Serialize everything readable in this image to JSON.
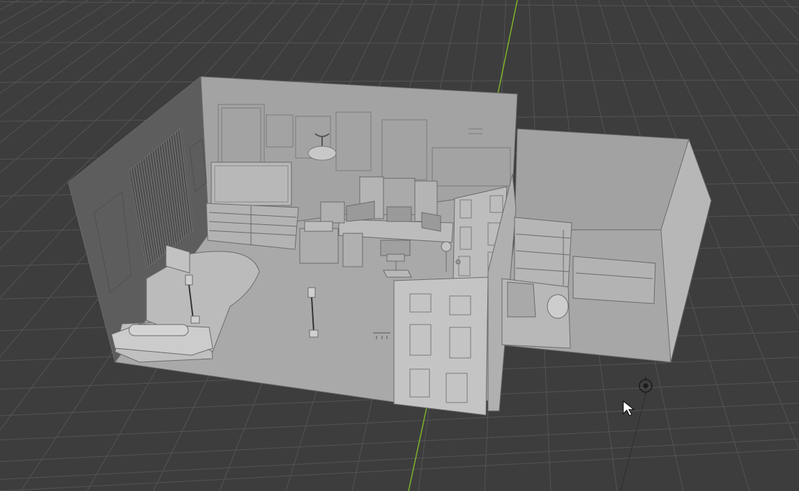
{
  "viewport": {
    "mode": "3d-viewport-solid-shading",
    "colors": {
      "background": "#3d3d3d",
      "grid": "#545454",
      "axis_y": "#7fb52a",
      "floor": "#a9a9a9",
      "wall_back": "#9f9f9f",
      "wall_left": "#5e5e5e",
      "wall_right": "#a5a5a5",
      "furniture": "#b4b4b4",
      "edge": "#6a6a6a"
    }
  },
  "scene": {
    "objects": [
      {
        "name": "bed"
      },
      {
        "name": "window-blinds"
      },
      {
        "name": "dresser"
      },
      {
        "name": "tv-screen"
      },
      {
        "name": "desk"
      },
      {
        "name": "monitors"
      },
      {
        "name": "office-chair"
      },
      {
        "name": "ceiling-lamp"
      },
      {
        "name": "floor-lamp"
      },
      {
        "name": "paneled-door-open"
      },
      {
        "name": "paneled-door-front"
      },
      {
        "name": "shelf-unit"
      },
      {
        "name": "cabinet"
      },
      {
        "name": "trash-bin"
      }
    ]
  },
  "gizmo": {
    "icon": "light-empty-icon"
  },
  "cursor": {
    "icon": "mouse-pointer-icon"
  }
}
